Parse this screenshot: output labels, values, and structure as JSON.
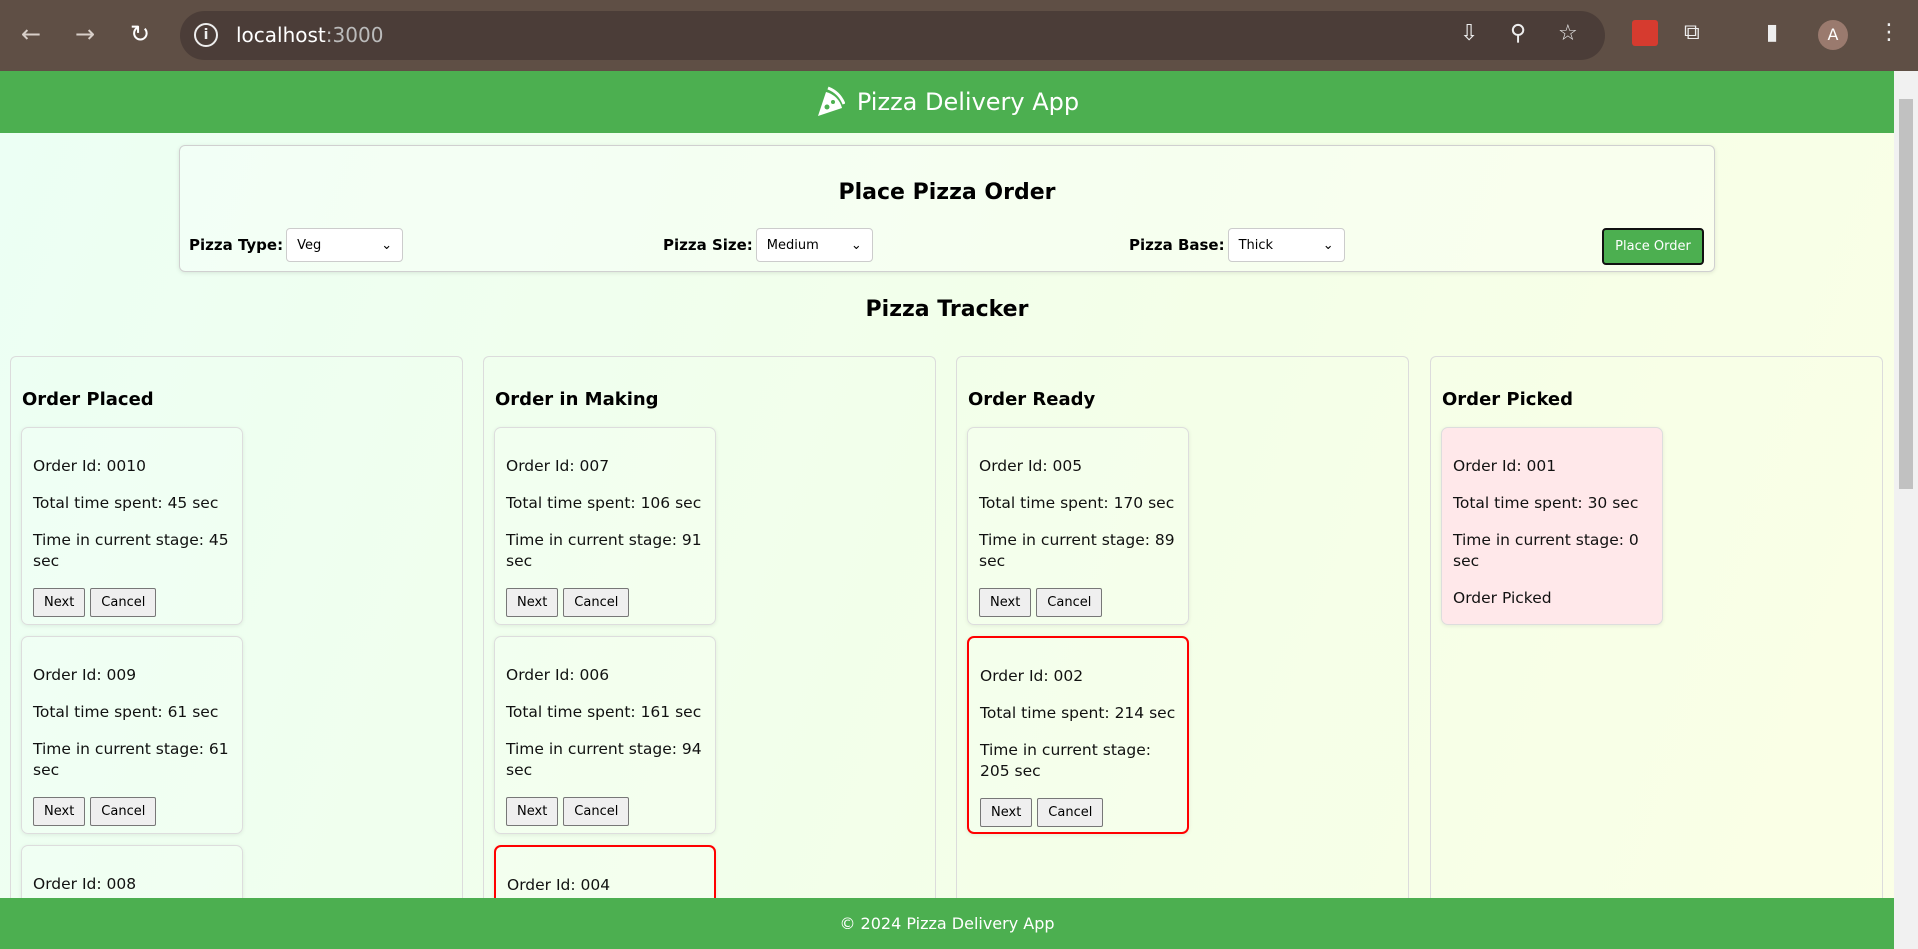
{
  "browser": {
    "url_host": "localhost",
    "url_port": ":3000",
    "avatar": "A"
  },
  "header": {
    "title": "Pizza Delivery App"
  },
  "form": {
    "title": "Place Pizza Order",
    "type_label": "Pizza Type:",
    "type_value": "Veg",
    "size_label": "Pizza Size:",
    "size_value": "Medium",
    "base_label": "Pizza Base:",
    "base_value": "Thick",
    "submit": "Place Order"
  },
  "tracker_title": "Pizza Tracker",
  "buttons": {
    "next": "Next",
    "cancel": "Cancel"
  },
  "columns": [
    {
      "title": "Order Placed",
      "cards": [
        {
          "id": "Order Id: 0010",
          "total": "Total time spent: 45 sec",
          "stage": "Time in current stage: 45 sec"
        },
        {
          "id": "Order Id: 009",
          "total": "Total time spent: 61 sec",
          "stage": "Time in current stage: 61 sec"
        },
        {
          "id": "Order Id: 008"
        }
      ]
    },
    {
      "title": "Order in Making",
      "cards": [
        {
          "id": "Order Id: 007",
          "total": "Total time spent: 106 sec",
          "stage": "Time in current stage: 91 sec"
        },
        {
          "id": "Order Id: 006",
          "total": "Total time spent: 161 sec",
          "stage": "Time in current stage: 94 sec"
        },
        {
          "id": "Order Id: 004",
          "delayed": true
        }
      ]
    },
    {
      "title": "Order Ready",
      "cards": [
        {
          "id": "Order Id: 005",
          "total": "Total time spent: 170 sec",
          "stage": "Time in current stage: 89 sec"
        },
        {
          "id": "Order Id: 002",
          "total": "Total time spent: 214 sec",
          "stage": "Time in current stage: 205 sec",
          "delayed": true
        }
      ]
    },
    {
      "title": "Order Picked",
      "cards": [
        {
          "id": "Order Id: 001",
          "total": "Total time spent: 30 sec",
          "stage": "Time in current stage: 0 sec",
          "status": "Order Picked"
        }
      ]
    }
  ],
  "footer": "© 2024 Pizza Delivery App",
  "colors": {
    "brand": "#4caf50",
    "delayed_border": "#ff0000",
    "picked_bg": "#ffe8ea"
  }
}
